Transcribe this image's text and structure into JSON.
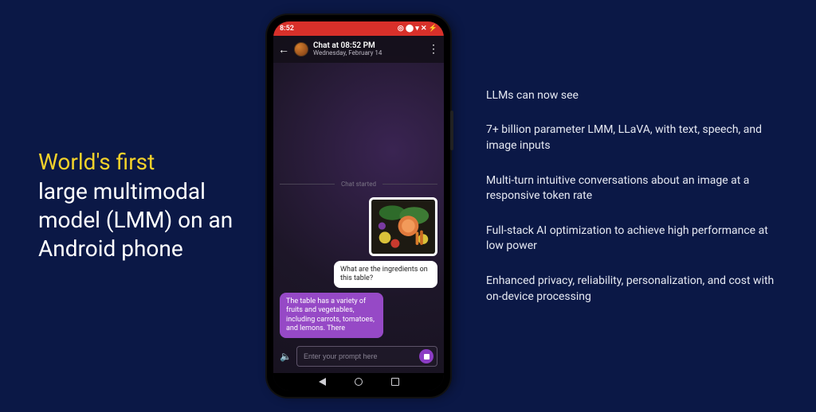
{
  "left": {
    "highlight": "World's first",
    "rest": "large multimodal model (LMM) on an Android phone"
  },
  "right": {
    "bullets": [
      "LLMs can now see",
      "7+ billion parameter LMM, LLaVA, with text, speech, and image inputs",
      "Multi-turn intuitive conversations about an image at a responsive token rate",
      "Full-stack AI optimization to achieve high performance at low power",
      "Enhanced privacy, reliability, personalization, and cost with on-device processing"
    ]
  },
  "phone": {
    "status": {
      "time": "8:52",
      "icons": "◎ ⬤  ▾ ✕ ⚡"
    },
    "appbar": {
      "title": "Chat at 08:52 PM",
      "subtitle": "Wednesday, February 14"
    },
    "chat": {
      "divider": "Chat started",
      "image_alt": "photo of assorted vegetables and salmon on a table",
      "user_msg": "What are the ingredients on this table?",
      "bot_msg": "The table has a variety of fruits and vegetables, including carrots, tomatoes, and lemons. There"
    },
    "composer": {
      "placeholder": "Enter your prompt here"
    }
  }
}
